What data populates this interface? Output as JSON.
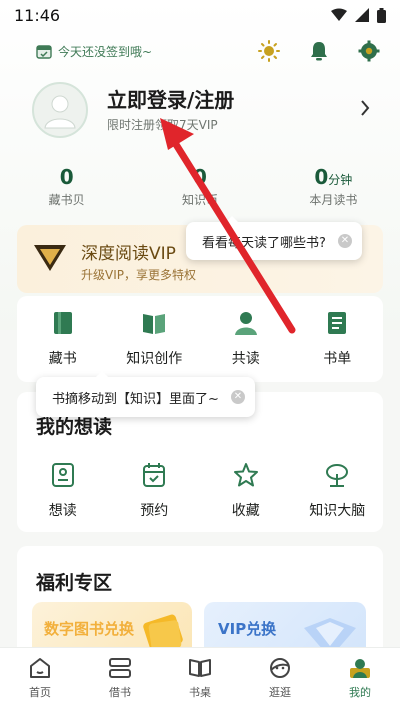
{
  "status_bar": {
    "time": "11:46"
  },
  "header": {
    "checkin_text": "今天还没签到哦~",
    "login_title": "立即登录/注册",
    "login_subtitle": "限时注册领取7天VIP"
  },
  "stats": [
    {
      "value": "0",
      "unit": "",
      "label": "藏书贝"
    },
    {
      "value": "0",
      "unit": "",
      "label": "知识币"
    },
    {
      "value": "0",
      "unit": "分钟",
      "label": "本月读书"
    }
  ],
  "vip": {
    "title": "深度阅读VIP",
    "subtitle": "升级VIP，享更多特权"
  },
  "quick_actions": [
    {
      "label": "藏书",
      "icon": "book-icon"
    },
    {
      "label": "知识创作",
      "icon": "open-book-icon"
    },
    {
      "label": "共读",
      "icon": "person-icon"
    },
    {
      "label": "书单",
      "icon": "list-icon"
    }
  ],
  "wishlist": {
    "title": "我的想读",
    "items": [
      {
        "label": "想读",
        "icon": "card-icon"
      },
      {
        "label": "预约",
        "icon": "calendar-icon"
      },
      {
        "label": "收藏",
        "icon": "star-icon"
      },
      {
        "label": "知识大脑",
        "icon": "tree-icon"
      }
    ]
  },
  "welfare": {
    "title": "福利专区",
    "card1": "数字图书兑换",
    "card2": "VIP兑换"
  },
  "tooltips": {
    "tip1": "看看每天读了哪些书?",
    "tip2": "书摘移动到【知识】里面了~"
  },
  "tabbar": [
    {
      "label": "首页",
      "icon": "home-icon"
    },
    {
      "label": "借书",
      "icon": "borrow-icon"
    },
    {
      "label": "书桌",
      "icon": "desk-icon"
    },
    {
      "label": "逛逛",
      "icon": "explore-icon"
    },
    {
      "label": "我的",
      "icon": "me-icon",
      "active": true
    }
  ],
  "colors": {
    "accent": "#2f7a52",
    "arrow": "#e0252b"
  }
}
